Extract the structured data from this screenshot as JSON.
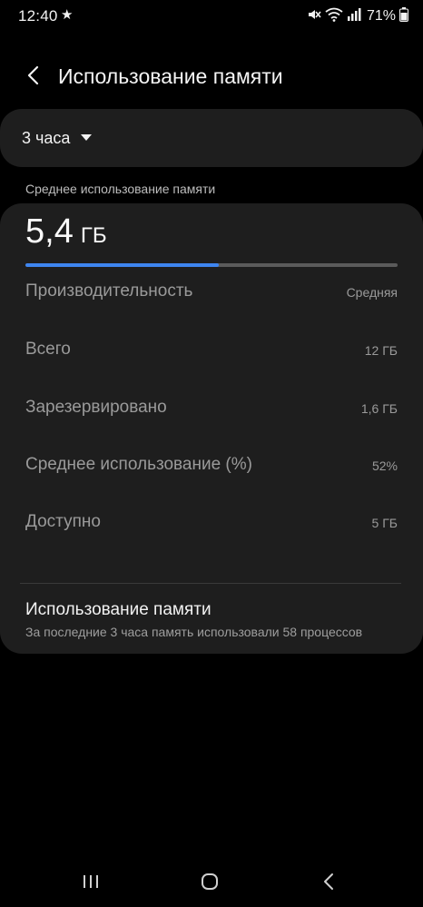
{
  "status_bar": {
    "time": "12:40",
    "battery_percent": "71%"
  },
  "header": {
    "title": "Использование памяти"
  },
  "period": {
    "selected": "3 часа"
  },
  "summary": {
    "caption": "Среднее использование памяти",
    "value": "5,4",
    "unit": "ГБ",
    "usage_fraction": 0.52
  },
  "details": [
    {
      "label": "Производительность",
      "value": "Средняя"
    },
    {
      "label": "Всего",
      "value": "12 ГБ"
    },
    {
      "label": "Зарезервировано",
      "value": "1,6 ГБ"
    },
    {
      "label": "Среднее использование (%)",
      "value": "52%"
    },
    {
      "label": "Доступно",
      "value": "5 ГБ"
    }
  ],
  "memory_link": {
    "title": "Использование памяти",
    "subtitle": "За последние 3 часа память использовали 58 процессов"
  },
  "icons": {
    "status_star": "star-icon",
    "mute": "mute-icon",
    "wifi": "wifi-icon",
    "signal": "signal-icon",
    "battery": "battery-icon",
    "back": "chevron-left-icon",
    "dropdown": "caret-down-icon",
    "nav_recents": "recents-icon",
    "nav_home": "home-icon",
    "nav_back": "back-icon"
  },
  "colors": {
    "background": "#000000",
    "card": "#1e1e1e",
    "accent": "#3e85f0",
    "track": "#5b5b5b",
    "secondary_text": "#9a9a9a"
  }
}
